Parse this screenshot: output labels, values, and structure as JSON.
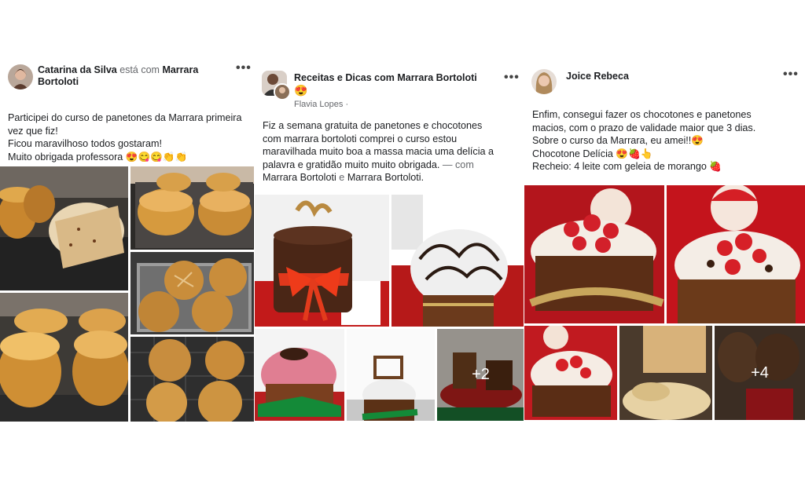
{
  "posts": [
    {
      "author": "Catarina da Silva",
      "with_text": "está com",
      "tagged": "Marrara Bortoloti",
      "lines": [
        "Participei do curso de panetones da Marrara primeira",
        "vez que fiz!",
        "Ficou maravilhoso todos gostaram!",
        "Muito obrigada professora 😍😋😋👏👏"
      ]
    },
    {
      "group": "Receitas e Dicas com Marrara Bortoloti",
      "group_emoji": "😍",
      "member": "Flavia Lopes",
      "member_sep": "·",
      "lines": [
        "Fiz a semana gratuita de panetones e chocotones",
        "com marrara bortoloti comprei o curso estou",
        "maravilhada muito boa a massa macia  uma delícia a",
        "palavra e gratidão  muito muito obrigada."
      ],
      "with_sep": " — com",
      "tag1": "Marrara Bortoloti",
      "tag_and": " e ",
      "tag2": "Marrara Bortoloti",
      "tag_end": ".",
      "more_count": "+2"
    },
    {
      "author": "Joice Rebeca",
      "lines": [
        "Enfim, consegui fazer os chocotones e panetones",
        "macios, com o prazo de validade maior que 3 dias.",
        "Sobre o curso da Marrara, eu amei!!😍",
        "Chocotone Delícia 😍🍓👆",
        "Recheio: 4 leite com geleia de morango 🍓"
      ],
      "more_count": "+4"
    }
  ],
  "menu_label": "•••",
  "colors": {
    "text": "#1c1e21",
    "muted": "#65676b",
    "background": "#ffffff"
  }
}
